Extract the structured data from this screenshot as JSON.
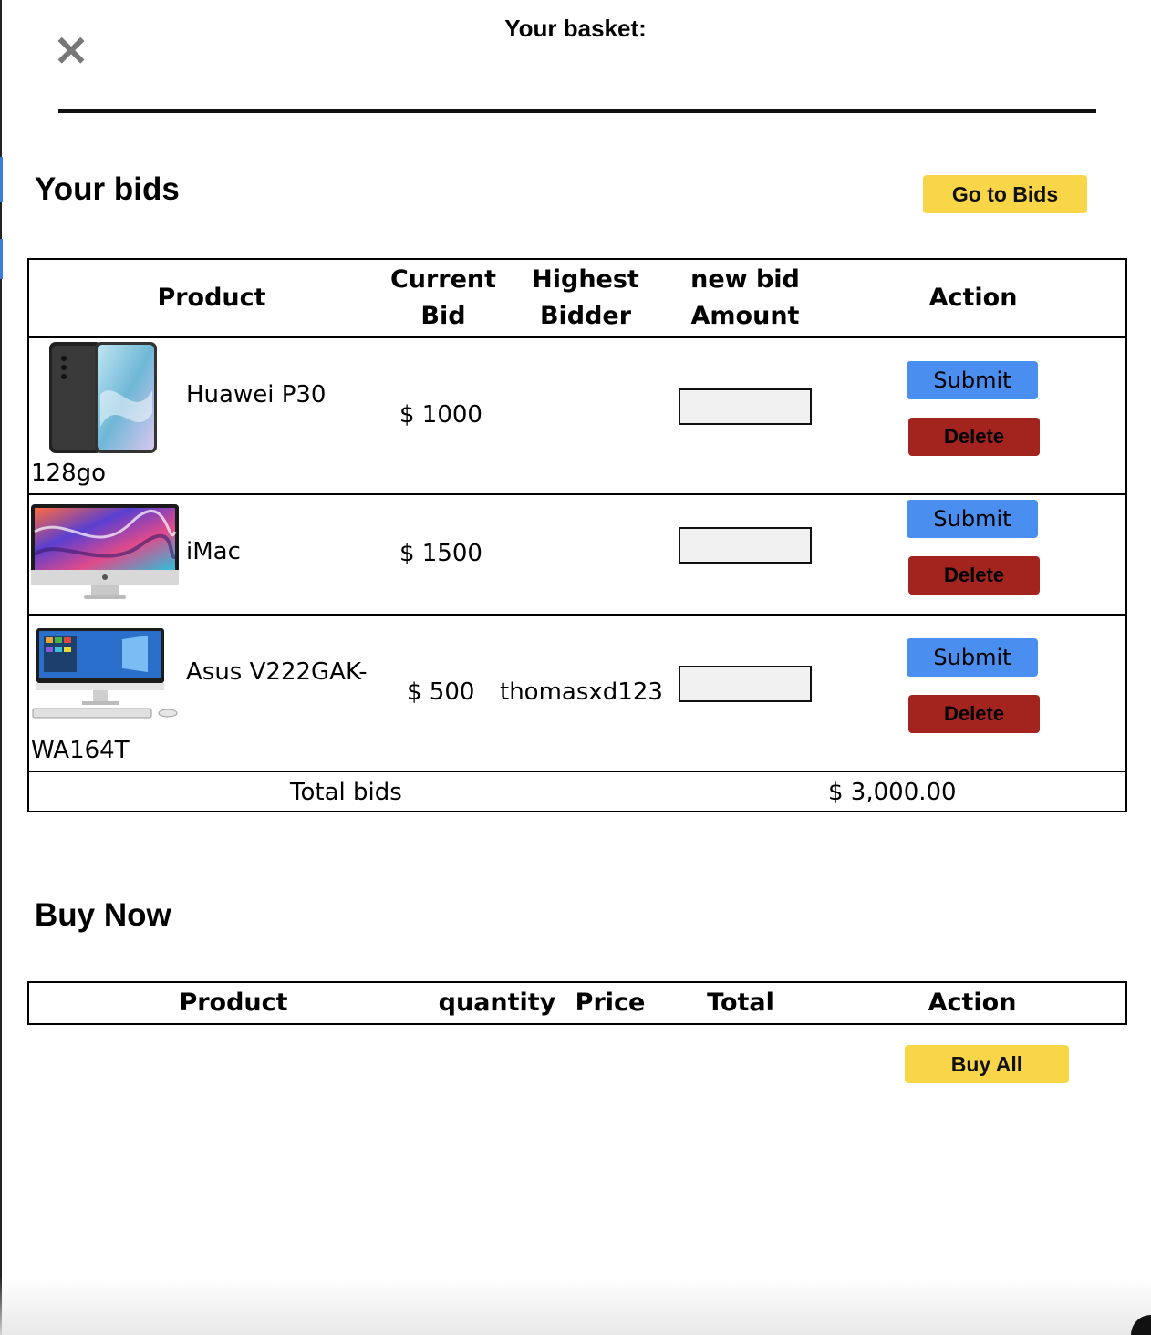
{
  "basket": {
    "title": "Your basket:",
    "close_symbol": "✕"
  },
  "bids_section": {
    "title": "Your bids",
    "go_to_bids_label": "Go to Bids",
    "columns": {
      "product": "Product",
      "current_bid_line1": "Current",
      "current_bid_line2": "Bid",
      "highest_bidder_line1": "Highest",
      "highest_bidder_line2": "Bidder",
      "new_bid_line1": "new bid",
      "new_bid_line2": "Amount",
      "action": "Action"
    },
    "rows": [
      {
        "name_line1": "Huawei P30",
        "name_line2": "128go",
        "current_bid": "$ 1000",
        "highest_bidder": "",
        "new_bid": "",
        "submit_label": "Submit",
        "delete_label": "Delete",
        "image_icon": "phone-image"
      },
      {
        "name_line1": "iMac",
        "name_line2": "",
        "current_bid": "$ 1500",
        "highest_bidder": "",
        "new_bid": "",
        "submit_label": "Submit",
        "delete_label": "Delete",
        "image_icon": "imac-image"
      },
      {
        "name_line1": "Asus V222GAK-",
        "name_line2": "WA164T",
        "current_bid": "$ 500",
        "highest_bidder": "thomasxd123",
        "new_bid": "",
        "submit_label": "Submit",
        "delete_label": "Delete",
        "image_icon": "desktop-image"
      }
    ],
    "total_label": "Total bids",
    "total_value": "$ 3,000.00"
  },
  "buy_now_section": {
    "title": "Buy Now",
    "columns": {
      "product": "Product",
      "quantity": "quantity",
      "price": "Price",
      "total": "Total",
      "action": "Action"
    },
    "buy_all_label": "Buy All"
  },
  "colors": {
    "yellow_button": "#f9d548",
    "submit_blue": "#4a8ef0",
    "delete_red": "#a3231f"
  }
}
